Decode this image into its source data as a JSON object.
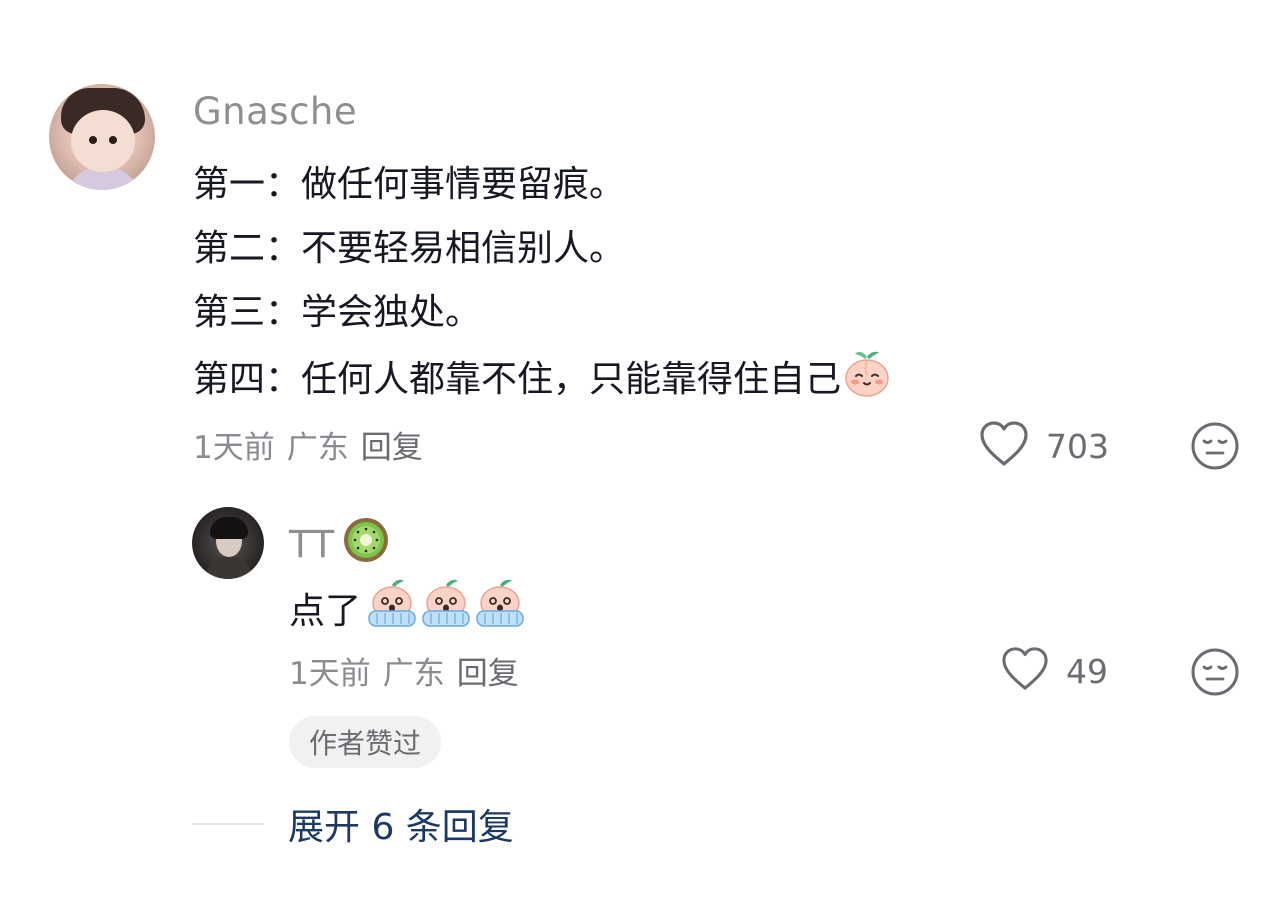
{
  "main_comment": {
    "username": "Gnasche",
    "lines": [
      "第一：做任何事情要留痕。",
      "第二：不要轻易相信别人。",
      "第三：学会独处。",
      "第四：任何人都靠不住，只能靠得住自己"
    ],
    "time": "1天前",
    "location": "广东",
    "reply_label": "回复",
    "like_count": "703",
    "emoji_after_line4": "peach-smile-emoji"
  },
  "reply_comment": {
    "username": "TT",
    "username_emoji": "kiwi-emoji",
    "text": "点了",
    "emojis": [
      "peach-crying-emoji",
      "peach-crying-emoji",
      "peach-crying-emoji"
    ],
    "time": "1天前",
    "location": "广东",
    "reply_label": "回复",
    "like_count": "49",
    "author_badge": "作者赞过"
  },
  "expand": {
    "label": "展开 6 条回复"
  },
  "colors": {
    "username": "#8e8e93",
    "text": "#161823",
    "meta": "#8a8b91",
    "link": "#1c3a63",
    "badge_bg": "#f1f1f2"
  }
}
